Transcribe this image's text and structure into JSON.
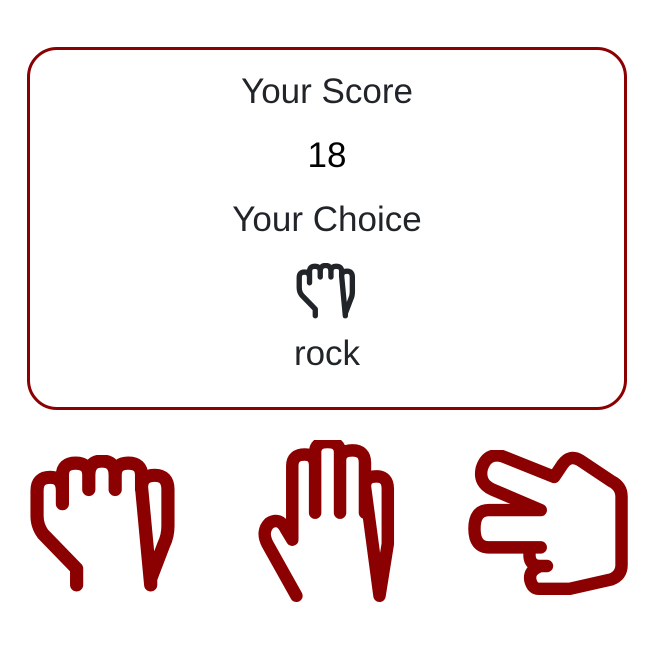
{
  "score_card": {
    "score_label": "Your Score",
    "score_value": "18",
    "choice_label": "Your Choice",
    "choice_icon": "hand-rock-icon",
    "choice_value": "rock"
  },
  "choices": [
    {
      "name": "rock",
      "icon": "hand-rock-icon"
    },
    {
      "name": "paper",
      "icon": "hand-paper-icon"
    },
    {
      "name": "scissors",
      "icon": "hand-scissors-icon"
    }
  ],
  "colors": {
    "accent": "#8b0000",
    "text": "#212529"
  }
}
